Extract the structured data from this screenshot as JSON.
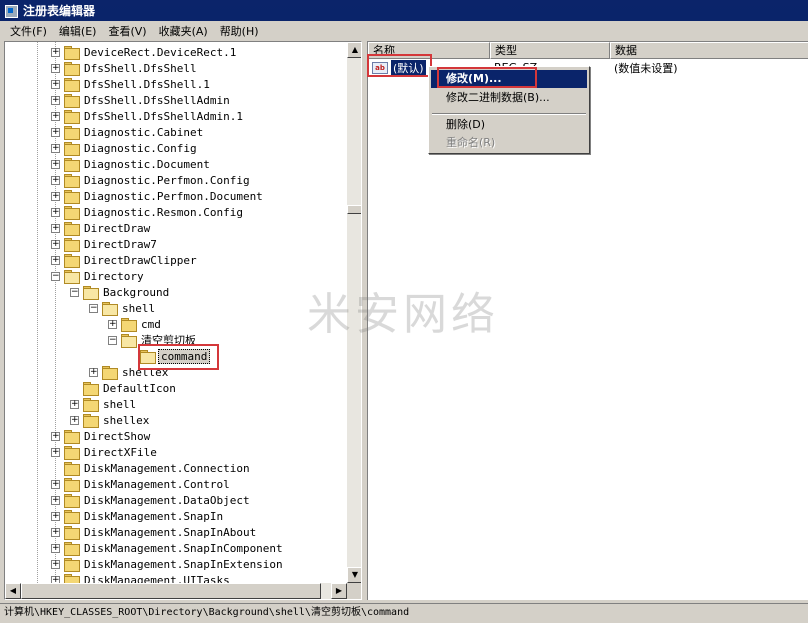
{
  "window": {
    "title": "注册表编辑器"
  },
  "menu": [
    "文件(F)",
    "编辑(E)",
    "查看(V)",
    "收藏夹(A)",
    "帮助(H)"
  ],
  "tree": {
    "items": [
      {
        "label": "DeviceRect.DeviceRect.1",
        "depth": 0,
        "expander": "+"
      },
      {
        "label": "DfsShell.DfsShell",
        "depth": 0,
        "expander": "+"
      },
      {
        "label": "DfsShell.DfsShell.1",
        "depth": 0,
        "expander": "+"
      },
      {
        "label": "DfsShell.DfsShellAdmin",
        "depth": 0,
        "expander": "+"
      },
      {
        "label": "DfsShell.DfsShellAdmin.1",
        "depth": 0,
        "expander": "+"
      },
      {
        "label": "Diagnostic.Cabinet",
        "depth": 0,
        "expander": "+"
      },
      {
        "label": "Diagnostic.Config",
        "depth": 0,
        "expander": "+"
      },
      {
        "label": "Diagnostic.Document",
        "depth": 0,
        "expander": "+"
      },
      {
        "label": "Diagnostic.Perfmon.Config",
        "depth": 0,
        "expander": "+"
      },
      {
        "label": "Diagnostic.Perfmon.Document",
        "depth": 0,
        "expander": "+"
      },
      {
        "label": "Diagnostic.Resmon.Config",
        "depth": 0,
        "expander": "+"
      },
      {
        "label": "DirectDraw",
        "depth": 0,
        "expander": "+"
      },
      {
        "label": "DirectDraw7",
        "depth": 0,
        "expander": "+"
      },
      {
        "label": "DirectDrawClipper",
        "depth": 0,
        "expander": "+"
      },
      {
        "label": "Directory",
        "depth": 0,
        "expander": "-"
      },
      {
        "label": "Background",
        "depth": 1,
        "expander": "-"
      },
      {
        "label": "shell",
        "depth": 2,
        "expander": "-"
      },
      {
        "label": "cmd",
        "depth": 3,
        "expander": "+"
      },
      {
        "label": "清空剪切板",
        "depth": 3,
        "expander": "-"
      },
      {
        "label": "command",
        "depth": 4,
        "expander": "",
        "selected": true
      },
      {
        "label": "shellex",
        "depth": 2,
        "expander": "+"
      },
      {
        "label": "DefaultIcon",
        "depth": 1,
        "expander": ""
      },
      {
        "label": "shell",
        "depth": 1,
        "expander": "+"
      },
      {
        "label": "shellex",
        "depth": 1,
        "expander": "+"
      },
      {
        "label": "DirectShow",
        "depth": 0,
        "expander": "+"
      },
      {
        "label": "DirectXFile",
        "depth": 0,
        "expander": "+"
      },
      {
        "label": "DiskManagement.Connection",
        "depth": 0,
        "expander": ""
      },
      {
        "label": "DiskManagement.Control",
        "depth": 0,
        "expander": "+"
      },
      {
        "label": "DiskManagement.DataObject",
        "depth": 0,
        "expander": "+"
      },
      {
        "label": "DiskManagement.SnapIn",
        "depth": 0,
        "expander": "+"
      },
      {
        "label": "DiskManagement.SnapInAbout",
        "depth": 0,
        "expander": "+"
      },
      {
        "label": "DiskManagement.SnapInComponent",
        "depth": 0,
        "expander": "+"
      },
      {
        "label": "DiskManagement.SnapInExtension",
        "depth": 0,
        "expander": "+"
      },
      {
        "label": "DiskManagement.UITasks",
        "depth": 0,
        "expander": "+"
      }
    ]
  },
  "list": {
    "columns": [
      "名称",
      "类型",
      "数据"
    ],
    "rows": [
      {
        "name": "(默认)",
        "type": "REG_SZ",
        "data": "(数值未设置)"
      }
    ]
  },
  "context_menu": {
    "items": [
      {
        "label": "修改(M)...",
        "state": "active"
      },
      {
        "label": "修改二进制数据(B)...",
        "state": "normal"
      },
      {
        "label": "删除(D)",
        "state": "normal"
      },
      {
        "label": "重命名(R)",
        "state": "disabled"
      }
    ]
  },
  "watermark": "米安网络",
  "status": {
    "path": "计算机\\HKEY_CLASSES_ROOT\\Directory\\Background\\shell\\清空剪切板\\command"
  },
  "colors": {
    "highlight": "#0a246a",
    "annotation": "#d4373a"
  }
}
